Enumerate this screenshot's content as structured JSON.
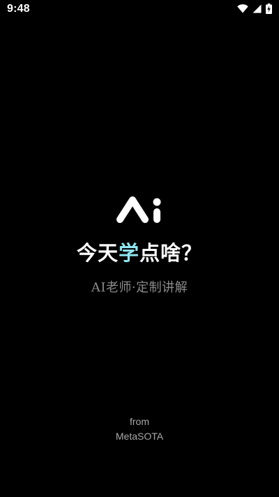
{
  "status_bar": {
    "time": "9:48",
    "icons": [
      "wifi-icon",
      "cellular-signal-icon",
      "battery-charging-icon"
    ]
  },
  "splash": {
    "logo": "ai-logo",
    "headline_before": "今天",
    "headline_highlight": "学",
    "headline_after": "点啥？",
    "subtitle": "AI老师·定制讲解",
    "from_label": "from",
    "brand": "MetaSOTA"
  },
  "colors": {
    "background": "#000000",
    "text": "#ffffff",
    "accent": "#8fe6f2",
    "muted": "#8a8a8a"
  }
}
